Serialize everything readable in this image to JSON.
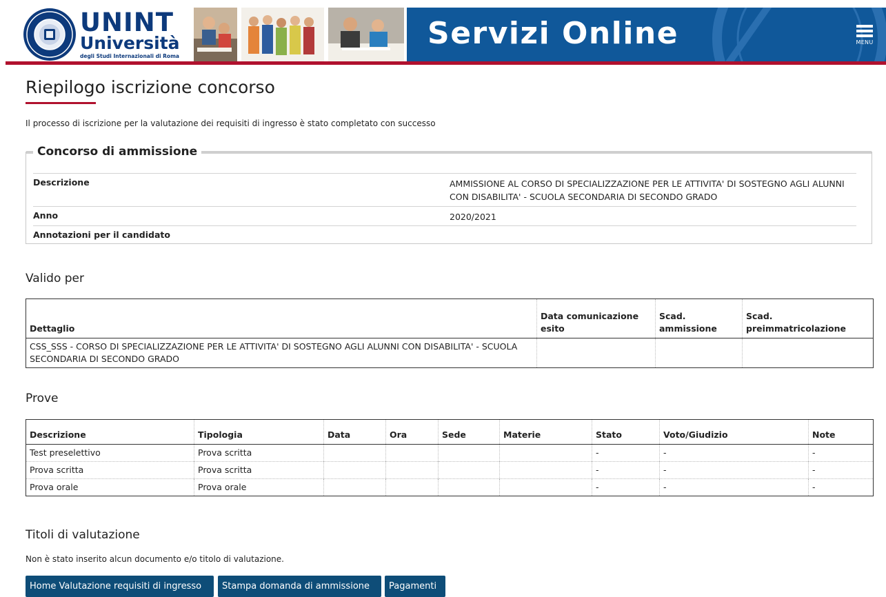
{
  "header": {
    "brand_line1": "UNINT",
    "brand_line2": "Università",
    "brand_line3": "degli Studi Internazionali di Roma",
    "seal_text_top": "degli Studi Internazionali",
    "seal_text_bottom": "Roma",
    "banner_title": "Servizi Online",
    "menu_label": "MENU",
    "colors": {
      "banner": "#10589a",
      "accent_red": "#b0112e",
      "brand_blue": "#0d3a7c"
    }
  },
  "page": {
    "title": "Riepilogo iscrizione concorso",
    "intro": "Il processo di iscrizione per la valutazione dei requisiti di ingresso è stato completato con successo"
  },
  "concorso": {
    "legend": "Concorso di ammissione",
    "rows": [
      {
        "label": "Descrizione",
        "value": "AMMISSIONE AL CORSO DI SPECIALIZZAZIONE PER LE ATTIVITA' DI SOSTEGNO AGLI ALUNNI CON DISABILITA' - SCUOLA SECONDARIA DI SECONDO GRADO"
      },
      {
        "label": "Anno",
        "value": "2020/2021"
      },
      {
        "label": "Annotazioni per il candidato",
        "value": ""
      }
    ]
  },
  "valido_per": {
    "title": "Valido per",
    "headers": [
      "Dettaglio",
      "Data comunicazione esito",
      "Scad. ammissione",
      "Scad. preimmatricolazione"
    ],
    "rows": [
      [
        "CSS_SSS - CORSO DI SPECIALIZZAZIONE PER LE ATTIVITA' DI SOSTEGNO AGLI ALUNNI CON DISABILITA' - SCUOLA SECONDARIA DI SECONDO GRADO",
        "",
        "",
        ""
      ]
    ]
  },
  "prove": {
    "title": "Prove",
    "headers": [
      "Descrizione",
      "Tipologia",
      "Data",
      "Ora",
      "Sede",
      "Materie",
      "Stato",
      "Voto/Giudizio",
      "Note"
    ],
    "rows": [
      [
        "Test preselettivo",
        "Prova scritta",
        "",
        "",
        "",
        "",
        "-",
        "-",
        "-"
      ],
      [
        "Prova scritta",
        "Prova scritta",
        "",
        "",
        "",
        "",
        "-",
        "-",
        "-"
      ],
      [
        "Prova orale",
        "Prova orale",
        "",
        "",
        "",
        "",
        "-",
        "-",
        "-"
      ]
    ]
  },
  "titoli": {
    "title": "Titoli di valutazione",
    "empty_message": "Non è stato inserito alcun documento e/o titolo di valutazione."
  },
  "buttons": {
    "home": "Home Valutazione requisiti di ingresso",
    "stampa": "Stampa domanda di ammissione",
    "pagamenti": "Pagamenti"
  }
}
